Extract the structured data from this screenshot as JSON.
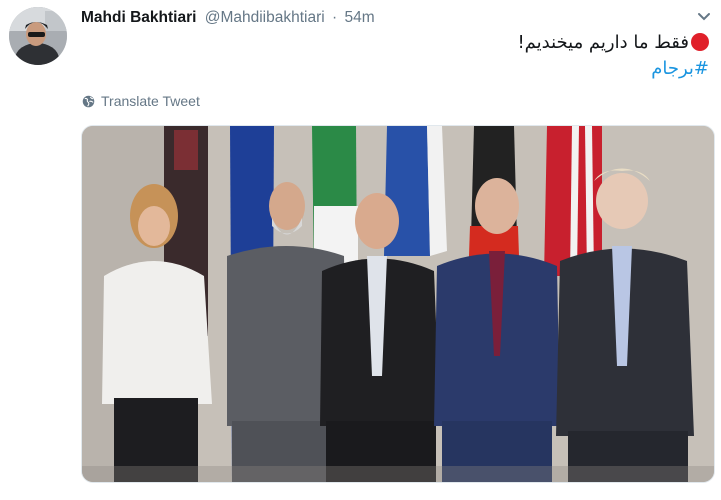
{
  "tweet": {
    "display_name": "Mahdi Bakhtiari",
    "handle": "@Mahdiibakhtiari",
    "separator": "·",
    "time": "54m",
    "text_line1": "فقط ما داریم میخندیم!",
    "hashtag": "#برجام",
    "translate_label": "Translate Tweet"
  },
  "icons": {
    "caret": "chevron-down-icon",
    "translate": "globe-icon",
    "status": "red-circle-emoji"
  },
  "colors": {
    "link": "#1b95e0",
    "muted": "#657786",
    "emoji_red": "#e0202a"
  }
}
